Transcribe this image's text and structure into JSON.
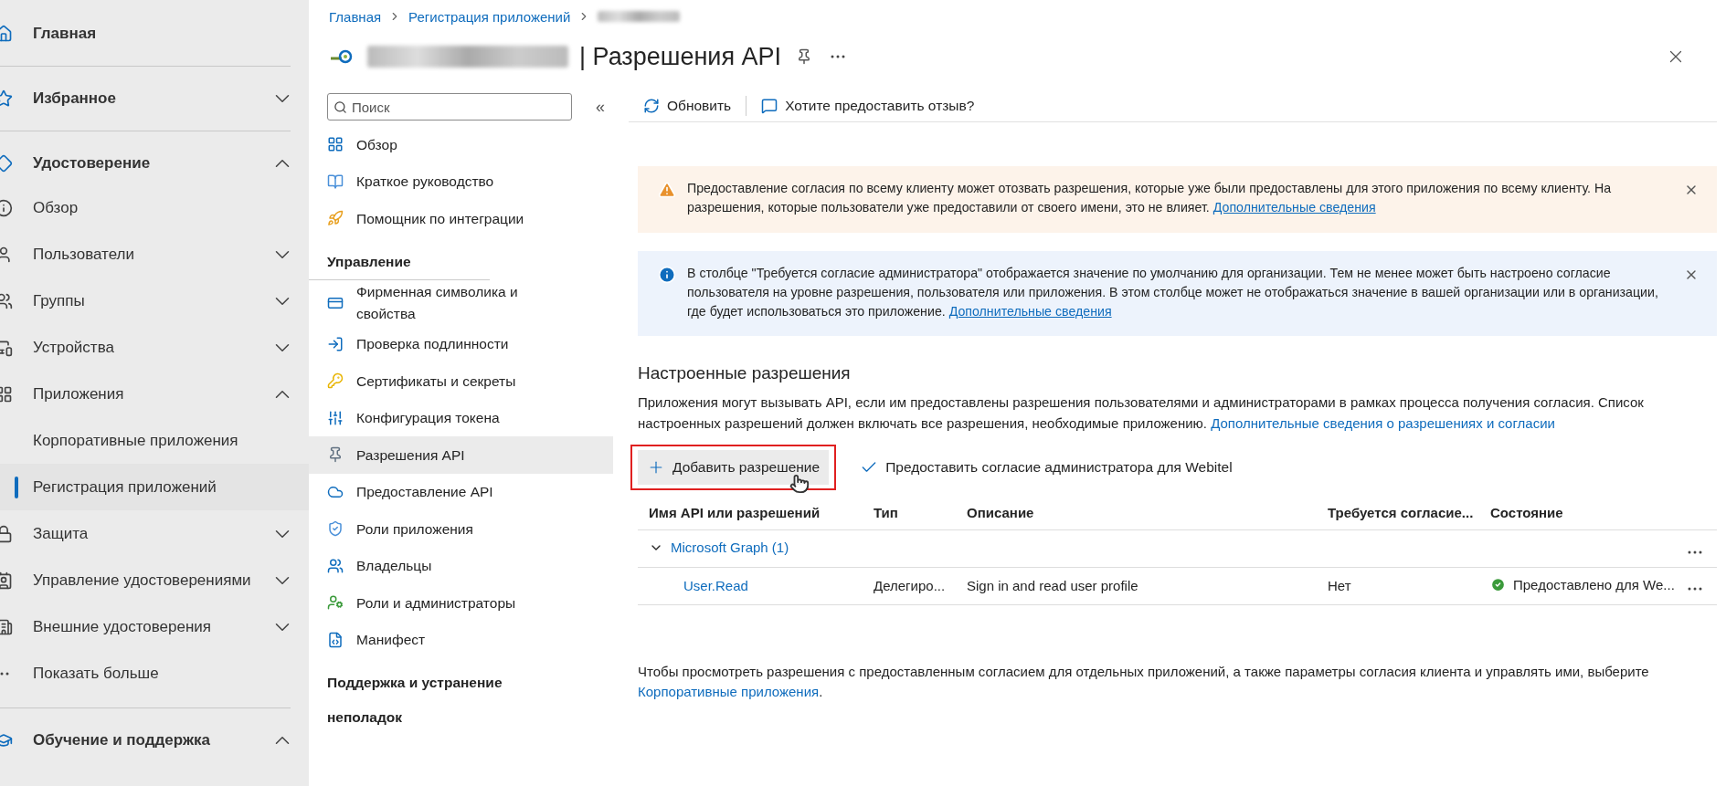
{
  "sidebar": {
    "items": [
      {
        "label": "Главная",
        "kind": "section",
        "selected": false,
        "divider_after": true
      },
      {
        "label": "Избранное",
        "kind": "section",
        "expanded": false,
        "selected": false,
        "divider_after": true
      },
      {
        "label": "Удостоверение",
        "kind": "section",
        "expanded": true,
        "selected": false
      },
      {
        "label": "Обзор",
        "kind": "item",
        "selected": false
      },
      {
        "label": "Пользователи",
        "kind": "item",
        "expanded": false,
        "selected": false
      },
      {
        "label": "Группы",
        "kind": "item",
        "expanded": false,
        "selected": false
      },
      {
        "label": "Устройства",
        "kind": "item",
        "expanded": false,
        "selected": false
      },
      {
        "label": "Приложения",
        "kind": "item",
        "expanded": true,
        "selected": false
      },
      {
        "label": "Корпоративные приложения",
        "kind": "subitem",
        "selected": false
      },
      {
        "label": "Регистрация приложений",
        "kind": "subitem",
        "selected": true
      },
      {
        "label": "Защита",
        "kind": "item",
        "expanded": false,
        "selected": false
      },
      {
        "label": "Управление удостоверениями",
        "kind": "item",
        "expanded": false,
        "selected": false
      },
      {
        "label": "Внешние удостоверения",
        "kind": "item",
        "expanded": false,
        "selected": false
      },
      {
        "label": "Показать больше",
        "kind": "item",
        "selected": false,
        "divider_after": true
      },
      {
        "label": "Обучение и поддержка",
        "kind": "section",
        "expanded": true,
        "selected": false
      }
    ]
  },
  "breadcrumb": [
    "Главная",
    "Регистрация приложений"
  ],
  "title": "| Разрешения API",
  "resource_nav": {
    "search": {
      "placeholder": "Поиск"
    },
    "collapse": "«",
    "items": [
      {
        "label": "Обзор",
        "kind": "item",
        "selected": false
      },
      {
        "label": "Краткое руководство",
        "kind": "item",
        "selected": false
      },
      {
        "label": "Помощник по интеграции",
        "kind": "item",
        "selected": false
      },
      {
        "label": "Управление",
        "kind": "heading"
      },
      {
        "label": "Фирменная символика и свойства",
        "kind": "item",
        "selected": false
      },
      {
        "label": "Проверка подлинности",
        "kind": "item",
        "selected": false
      },
      {
        "label": "Сертификаты и секреты",
        "kind": "item",
        "selected": false
      },
      {
        "label": "Конфигурация токена",
        "kind": "item",
        "selected": false
      },
      {
        "label": "Разрешения API",
        "kind": "item",
        "selected": true
      },
      {
        "label": "Предоставление API",
        "kind": "item",
        "selected": false
      },
      {
        "label": "Роли приложения",
        "kind": "item",
        "selected": false
      },
      {
        "label": "Владельцы",
        "kind": "item",
        "selected": false
      },
      {
        "label": "Роли и администраторы",
        "kind": "item",
        "selected": false
      },
      {
        "label": "Манифест",
        "kind": "item",
        "selected": false
      },
      {
        "label": "Поддержка и устранение",
        "kind": "heading"
      },
      {
        "label": "неполадок",
        "kind": "heading"
      }
    ]
  },
  "toolbar": [
    "Обновить",
    "Хотите предоставить отзыв?"
  ],
  "banners": [
    {
      "kind": "warning",
      "text": "Предоставление согласия по всему клиенту может отозвать разрешения, которые уже были предоставлены для этого приложения по всему клиенту. На разрешения, которые пользователи уже предоставили от своего имени, это не влияет.",
      "link": "Дополнительные сведения"
    },
    {
      "kind": "info",
      "text": "В столбце \"Требуется согласие администратора\" отображается значение по умолчанию для организации. Тем не менее может быть настроено согласие пользователя на уровне разрешения, пользователя или приложения. В этом столбце может не отображаться значение в вашей организации или в организации, где будет использоваться это приложение.",
      "link": "Дополнительные сведения"
    }
  ],
  "section": {
    "title": "Настроенные разрешения",
    "text": "Приложения могут вызывать API, если им предоставлены разрешения пользователями и администраторами в рамках процесса получения согласия. Список настроенных разрешений должен включать все разрешения, необходимые приложению.",
    "link": "Дополнительные сведения о разрешениях и согласии"
  },
  "actions": [
    {
      "label": "Добавить разрешение",
      "kind": "add",
      "highlighted": true
    },
    {
      "label": "Предоставить согласие администратора для Webitel",
      "kind": "grant",
      "highlighted": false
    }
  ],
  "table": {
    "columns": [
      "Имя API или разрешений",
      "Тип",
      "Описание",
      "Требуется согласие...",
      "Состояние"
    ],
    "groups": [
      {
        "name": "Microsoft Graph (1)",
        "expanded": true,
        "rows": [
          {
            "name": "User.Read",
            "type": "Делегиро...",
            "description": "Sign in and read user profile",
            "admin_consent": "Нет",
            "status": "Предоставлено для We..."
          }
        ]
      }
    ]
  },
  "footer": {
    "text": "Чтобы просмотреть разрешения с предоставленным согласием для отдельных приложений, а также параметры согласия клиента и управлять ими, выберите",
    "link": "Корпоративные приложения",
    "after_link": "."
  }
}
